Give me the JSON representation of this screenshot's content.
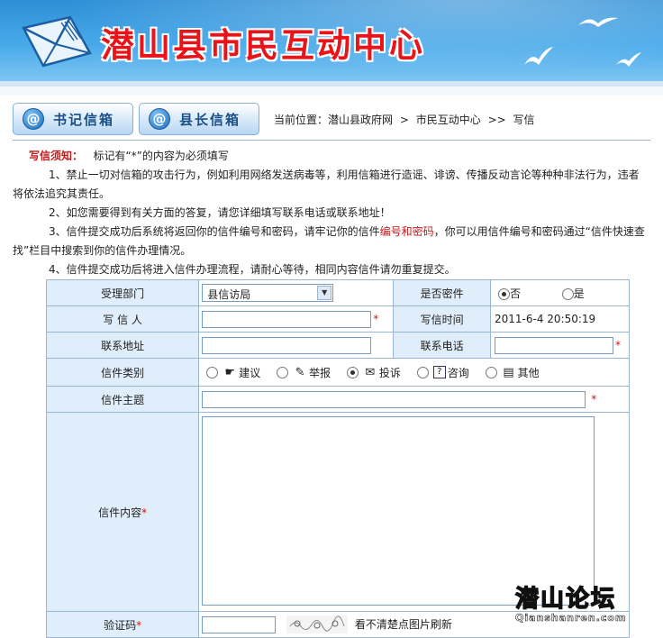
{
  "header": {
    "title": "潜山县市民互动中心"
  },
  "nav": {
    "btn1": "书记信箱",
    "btn2": "县长信箱",
    "at": "@",
    "crumb_prefix": "当前位置：",
    "crumb_1": "潜山县政府网",
    "crumb_sep1": ">",
    "crumb_2": "市民互动中心",
    "crumb_sep2": ">>",
    "crumb_3": "写信"
  },
  "notice": {
    "head": "写信须知：",
    "intro": "标记有“*”的内容为必须填写",
    "item1": "1、禁止一切对信箱的攻击行为，例如利用网络发送病毒等，利用信箱进行造谣、诽谤、传播反动言论等种种非法行为，违者将依法追究其责任。",
    "item2": "2、如您需要得到有关方面的答复，请您详细填写联系电话或联系地址！",
    "item3a": "3、信件提交成功后系统将返回你的信件编号和密码，请牢记你的信件",
    "item3b": "编号和密码",
    "item3c": "，你可以用信件编号和密码通过“信件快速查找”栏目中搜索到你的信件办理情况。",
    "item4": "4、信件提交成功后将进入信件办理流程，请耐心等待，相同内容信件请勿重复提交。"
  },
  "form": {
    "dept_label": "受理部门",
    "dept_value": "县信访局",
    "secret_label": "是否密件",
    "secret_no": "否",
    "secret_yes": "是",
    "writer_label": "写 信 人",
    "time_label": "写信时间",
    "time_value": "2011-6-4 20:50:19",
    "addr_label": "联系地址",
    "phone_label": "联系电话",
    "type_label": "信件类别",
    "types": [
      "建议",
      "举报",
      "投诉",
      "咨询",
      "其他"
    ],
    "subject_label": "信件主题",
    "content_label": "信件内容",
    "code_label": "验证码",
    "code_hint": "看不清楚点图片刷新",
    "star": "*"
  },
  "watermark": {
    "big": "潜山论坛",
    "small": "Qianshanren.com"
  },
  "colors": {
    "banner": "#3fa0e4",
    "title": "#e8141a",
    "label_bg": "#dfeefa",
    "border": "#9ab6d2",
    "required": "#d01414"
  }
}
